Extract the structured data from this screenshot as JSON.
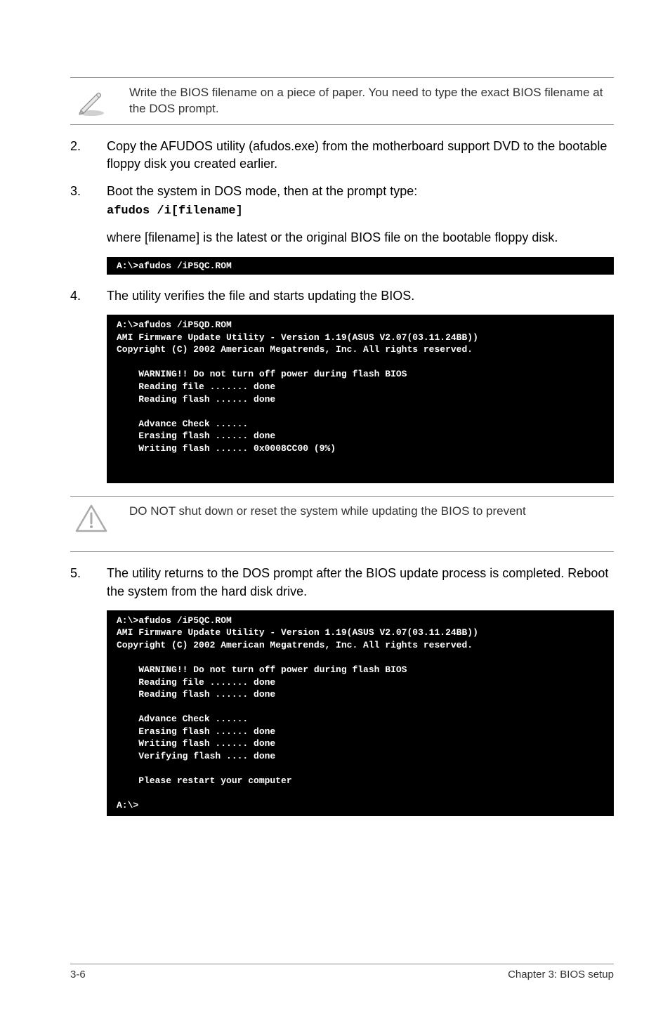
{
  "note1": {
    "text": "Write the BIOS filename on a piece of paper. You need to type the exact BIOS filename at the DOS prompt."
  },
  "step2": {
    "num": "2.",
    "text": "Copy the AFUDOS utility (afudos.exe) from the motherboard support DVD to the bootable floppy disk you created earlier."
  },
  "step3": {
    "num": "3.",
    "line1": "Boot the system in DOS mode, then at the prompt type:",
    "cmd": "afudos /i[filename]"
  },
  "para3a": "where [filename] is the latest or the original BIOS file on the bootable floppy disk.",
  "terminal1": "A:\\>afudos /iP5QC.ROM",
  "step4": {
    "num": "4.",
    "text": "The utility verifies the file and starts updating the BIOS."
  },
  "terminal2": "A:\\>afudos /iP5QD.ROM\nAMI Firmware Update Utility - Version 1.19(ASUS V2.07(03.11.24BB))\nCopyright (C) 2002 American Megatrends, Inc. All rights reserved.\n\n    WARNING!! Do not turn off power during flash BIOS\n    Reading file ....... done\n    Reading flash ...... done\n\n    Advance Check ......\n    Erasing flash ...... done\n    Writing flash ...... 0x0008CC00 (9%)\n\n\n",
  "note2": {
    "text": "DO NOT shut down or reset the system while updating the BIOS to prevent"
  },
  "step5": {
    "num": "5.",
    "text": "The utility returns to the DOS prompt after the BIOS update process is completed. Reboot the system from the hard disk drive."
  },
  "terminal3": "A:\\>afudos /iP5QC.ROM\nAMI Firmware Update Utility - Version 1.19(ASUS V2.07(03.11.24BB))\nCopyright (C) 2002 American Megatrends, Inc. All rights reserved.\n\n    WARNING!! Do not turn off power during flash BIOS\n    Reading file ....... done\n    Reading flash ...... done\n\n    Advance Check ......\n    Erasing flash ...... done\n    Writing flash ...... done\n    Verifying flash .... done\n\n    Please restart your computer\n\nA:\\>",
  "footer": {
    "left": "3-6",
    "right": "Chapter 3: BIOS setup"
  }
}
